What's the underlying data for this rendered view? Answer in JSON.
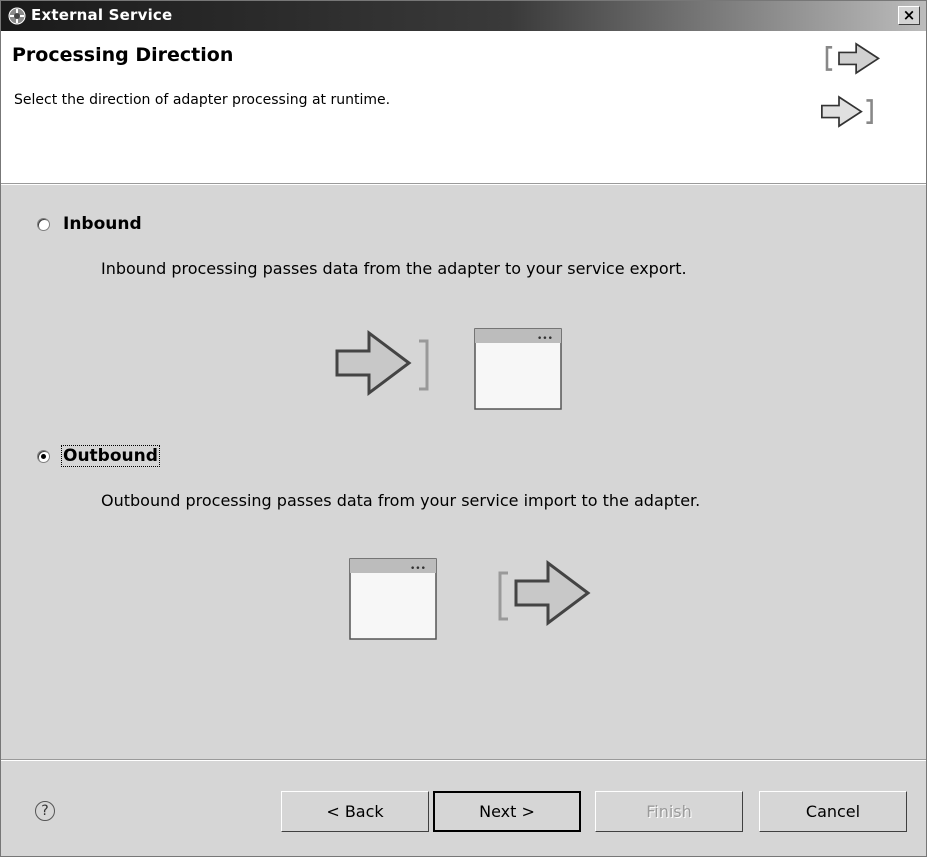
{
  "window": {
    "title": "External Service",
    "close_label": "×"
  },
  "header": {
    "title": "Processing Direction",
    "description": "Select the direction of adapter processing at runtime."
  },
  "options": [
    {
      "label": "Inbound",
      "description": "Inbound processing passes data from the adapter to your service export.",
      "selected": false
    },
    {
      "label": "Outbound",
      "description": "Outbound processing passes data from your service import to the adapter.",
      "selected": true
    }
  ],
  "footer": {
    "help_label": "?",
    "back_label": "< Back",
    "next_label": "Next >",
    "finish_label": "Finish",
    "cancel_label": "Cancel"
  }
}
